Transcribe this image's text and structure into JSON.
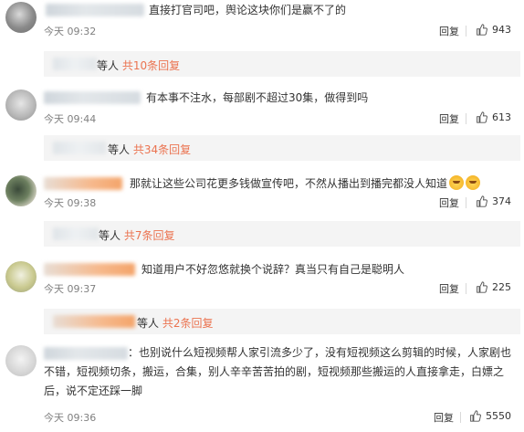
{
  "comments": [
    {
      "text": "直接打官司吧，舆论这块你们是赢不了的",
      "time": "今天 09:32",
      "reply_label": "回复",
      "likes": "943",
      "thread": {
        "suffix": "等人 ",
        "more": "共10条回复"
      }
    },
    {
      "text": "有本事不注水，每部剧不超过30集，做得到吗",
      "time": "今天 09:44",
      "reply_label": "回复",
      "likes": "613",
      "thread": {
        "suffix": "等人 ",
        "more": "共34条回复"
      }
    },
    {
      "text": "那就让这些公司花更多钱做宣传吧，不然从播出到播完都没人知道",
      "time": "今天 09:38",
      "reply_label": "回复",
      "likes": "374",
      "thread": {
        "suffix": "等人 ",
        "more": "共7条回复"
      }
    },
    {
      "text": "知道用户不好忽悠就换个说辞？真当只有自己是聪明人",
      "time": "今天 09:37",
      "reply_label": "回复",
      "likes": "225",
      "thread": {
        "suffix": "等人 ",
        "more": "共2条回复"
      }
    },
    {
      "text": "：也别说什么短视频帮人家引流多少了，没有短视频这么剪辑的时候，人家剧也不错，短视频切条，搬运，合集，别人辛辛苦苦拍的剧，短视频那些搬运的人直接拿走，白嫖之后，说不定还踩一脚",
      "time": "今天 09:36",
      "reply_label": "回复",
      "likes": "5550"
    }
  ],
  "icons": {
    "like": "thumbs-up-icon",
    "emoji": "cat-face-emoji"
  },
  "colors": {
    "link": "#eb7350",
    "time": "#808080",
    "thread_bg": "#f4f4f4"
  }
}
